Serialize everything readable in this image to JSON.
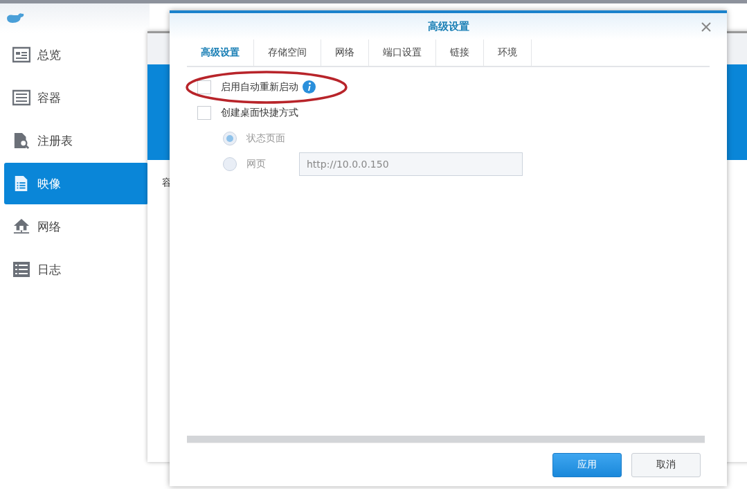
{
  "sidebar": {
    "items": [
      {
        "label": "总览",
        "selected": false
      },
      {
        "label": "容器",
        "selected": false
      },
      {
        "label": "注册表",
        "selected": false
      },
      {
        "label": "映像",
        "selected": true
      },
      {
        "label": "网络",
        "selected": false
      },
      {
        "label": "日志",
        "selected": false
      }
    ]
  },
  "background_window": {
    "label": "容"
  },
  "dialog": {
    "title": "高级设置",
    "tabs": [
      {
        "label": "高级设置",
        "selected": true
      },
      {
        "label": "存储空间",
        "selected": false
      },
      {
        "label": "网络",
        "selected": false
      },
      {
        "label": "端口设置",
        "selected": false
      },
      {
        "label": "链接",
        "selected": false
      },
      {
        "label": "环境",
        "selected": false
      }
    ],
    "options": [
      {
        "kind": "checkbox",
        "label": "启用自动重新启动",
        "checked": false,
        "info": true,
        "highlighted": true
      },
      {
        "kind": "checkbox",
        "label": "创建桌面快捷方式",
        "checked": false,
        "info": false,
        "highlighted": false
      },
      {
        "kind": "radio",
        "label": "状态页面",
        "selected": true,
        "disabled": true
      },
      {
        "kind": "radio",
        "label": "网页",
        "selected": false,
        "disabled": true,
        "value": "http://10.0.0.150"
      }
    ],
    "buttons": [
      {
        "label": "应用",
        "kind": "primary"
      },
      {
        "label": "取消",
        "kind": "secondary"
      }
    ]
  }
}
